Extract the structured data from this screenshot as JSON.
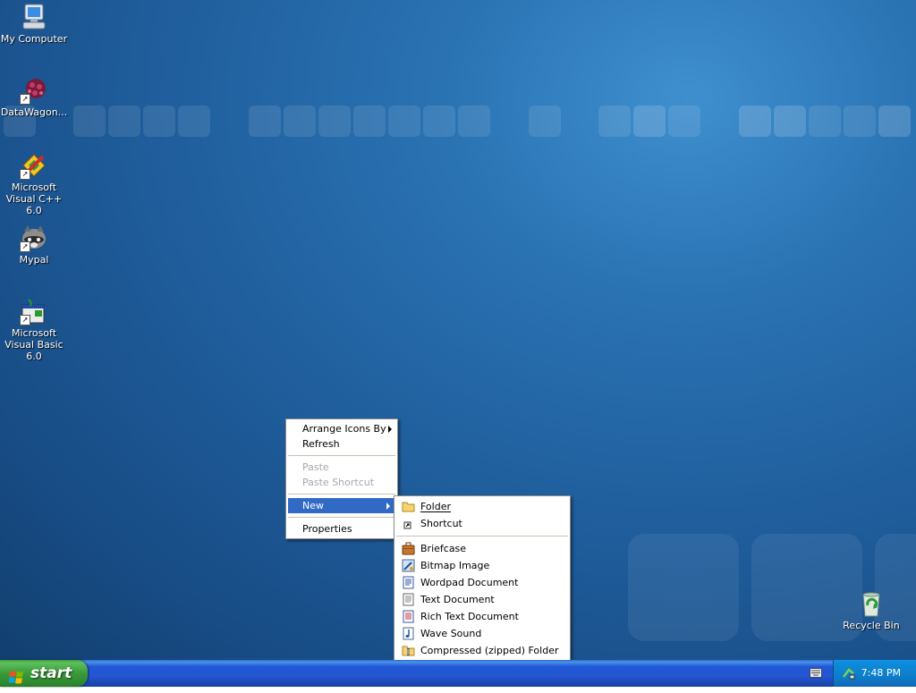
{
  "desktop": {
    "icons": [
      {
        "label": "My Computer",
        "icon": "my-computer-icon"
      },
      {
        "label": "DataWagon...",
        "icon": "datawagon-icon"
      },
      {
        "label": "Microsoft Visual C++ 6.0",
        "icon": "visual-cpp-icon"
      },
      {
        "label": "Mypal",
        "icon": "mypal-raccoon-icon"
      },
      {
        "label": "Microsoft Visual Basic 6.0",
        "icon": "visual-basic-icon"
      },
      {
        "label": "Recycle Bin",
        "icon": "recycle-bin-icon"
      }
    ]
  },
  "context_menu": {
    "items": [
      {
        "label": "Arrange Icons By",
        "submenu": true,
        "enabled": true
      },
      {
        "label": "Refresh",
        "enabled": true
      },
      {
        "label": "Paste",
        "enabled": false
      },
      {
        "label": "Paste Shortcut",
        "enabled": false
      },
      {
        "label": "New",
        "submenu": true,
        "selected": true
      },
      {
        "label": "Properties",
        "enabled": true
      }
    ]
  },
  "new_submenu": {
    "items": [
      {
        "label": "Folder",
        "icon": "folder-icon"
      },
      {
        "label": "Shortcut",
        "icon": "shortcut-icon"
      },
      {
        "label": "Briefcase",
        "icon": "briefcase-icon"
      },
      {
        "label": "Bitmap Image",
        "icon": "bitmap-icon"
      },
      {
        "label": "Wordpad Document",
        "icon": "wordpad-icon"
      },
      {
        "label": "Text Document",
        "icon": "text-document-icon"
      },
      {
        "label": "Rich Text Document",
        "icon": "rich-text-icon"
      },
      {
        "label": "Wave Sound",
        "icon": "wave-sound-icon"
      },
      {
        "label": "Compressed (zipped) Folder",
        "icon": "zip-folder-icon"
      }
    ]
  },
  "taskbar": {
    "start_label": "start",
    "clock": "7:48 PM"
  },
  "colors": {
    "menu_highlight": "#316ac5",
    "taskbar_blue": "#2456d0",
    "start_green": "#3a9a3a"
  }
}
